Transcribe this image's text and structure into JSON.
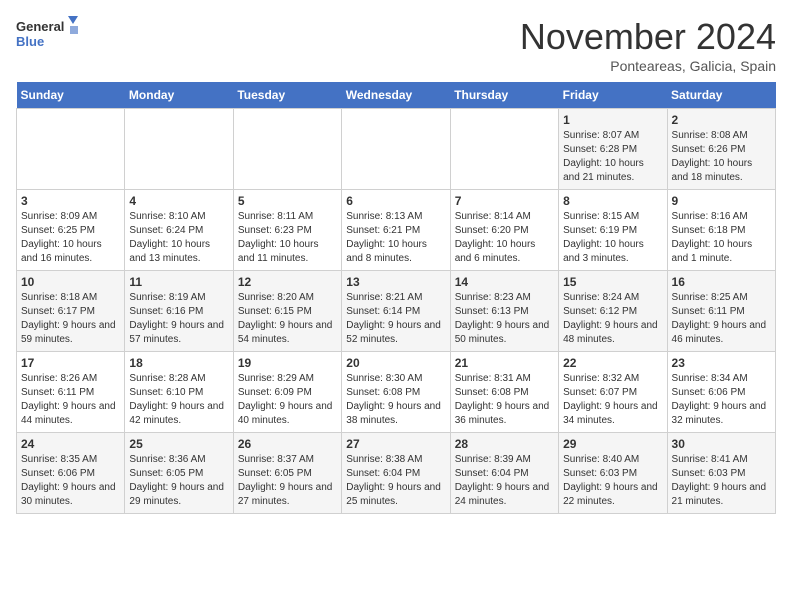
{
  "header": {
    "logo_line1": "General",
    "logo_line2": "Blue",
    "month": "November 2024",
    "location": "Ponteareas, Galicia, Spain"
  },
  "weekdays": [
    "Sunday",
    "Monday",
    "Tuesday",
    "Wednesday",
    "Thursday",
    "Friday",
    "Saturday"
  ],
  "weeks": [
    [
      {
        "day": "",
        "info": ""
      },
      {
        "day": "",
        "info": ""
      },
      {
        "day": "",
        "info": ""
      },
      {
        "day": "",
        "info": ""
      },
      {
        "day": "",
        "info": ""
      },
      {
        "day": "1",
        "info": "Sunrise: 8:07 AM\nSunset: 6:28 PM\nDaylight: 10 hours and 21 minutes."
      },
      {
        "day": "2",
        "info": "Sunrise: 8:08 AM\nSunset: 6:26 PM\nDaylight: 10 hours and 18 minutes."
      }
    ],
    [
      {
        "day": "3",
        "info": "Sunrise: 8:09 AM\nSunset: 6:25 PM\nDaylight: 10 hours and 16 minutes."
      },
      {
        "day": "4",
        "info": "Sunrise: 8:10 AM\nSunset: 6:24 PM\nDaylight: 10 hours and 13 minutes."
      },
      {
        "day": "5",
        "info": "Sunrise: 8:11 AM\nSunset: 6:23 PM\nDaylight: 10 hours and 11 minutes."
      },
      {
        "day": "6",
        "info": "Sunrise: 8:13 AM\nSunset: 6:21 PM\nDaylight: 10 hours and 8 minutes."
      },
      {
        "day": "7",
        "info": "Sunrise: 8:14 AM\nSunset: 6:20 PM\nDaylight: 10 hours and 6 minutes."
      },
      {
        "day": "8",
        "info": "Sunrise: 8:15 AM\nSunset: 6:19 PM\nDaylight: 10 hours and 3 minutes."
      },
      {
        "day": "9",
        "info": "Sunrise: 8:16 AM\nSunset: 6:18 PM\nDaylight: 10 hours and 1 minute."
      }
    ],
    [
      {
        "day": "10",
        "info": "Sunrise: 8:18 AM\nSunset: 6:17 PM\nDaylight: 9 hours and 59 minutes."
      },
      {
        "day": "11",
        "info": "Sunrise: 8:19 AM\nSunset: 6:16 PM\nDaylight: 9 hours and 57 minutes."
      },
      {
        "day": "12",
        "info": "Sunrise: 8:20 AM\nSunset: 6:15 PM\nDaylight: 9 hours and 54 minutes."
      },
      {
        "day": "13",
        "info": "Sunrise: 8:21 AM\nSunset: 6:14 PM\nDaylight: 9 hours and 52 minutes."
      },
      {
        "day": "14",
        "info": "Sunrise: 8:23 AM\nSunset: 6:13 PM\nDaylight: 9 hours and 50 minutes."
      },
      {
        "day": "15",
        "info": "Sunrise: 8:24 AM\nSunset: 6:12 PM\nDaylight: 9 hours and 48 minutes."
      },
      {
        "day": "16",
        "info": "Sunrise: 8:25 AM\nSunset: 6:11 PM\nDaylight: 9 hours and 46 minutes."
      }
    ],
    [
      {
        "day": "17",
        "info": "Sunrise: 8:26 AM\nSunset: 6:11 PM\nDaylight: 9 hours and 44 minutes."
      },
      {
        "day": "18",
        "info": "Sunrise: 8:28 AM\nSunset: 6:10 PM\nDaylight: 9 hours and 42 minutes."
      },
      {
        "day": "19",
        "info": "Sunrise: 8:29 AM\nSunset: 6:09 PM\nDaylight: 9 hours and 40 minutes."
      },
      {
        "day": "20",
        "info": "Sunrise: 8:30 AM\nSunset: 6:08 PM\nDaylight: 9 hours and 38 minutes."
      },
      {
        "day": "21",
        "info": "Sunrise: 8:31 AM\nSunset: 6:08 PM\nDaylight: 9 hours and 36 minutes."
      },
      {
        "day": "22",
        "info": "Sunrise: 8:32 AM\nSunset: 6:07 PM\nDaylight: 9 hours and 34 minutes."
      },
      {
        "day": "23",
        "info": "Sunrise: 8:34 AM\nSunset: 6:06 PM\nDaylight: 9 hours and 32 minutes."
      }
    ],
    [
      {
        "day": "24",
        "info": "Sunrise: 8:35 AM\nSunset: 6:06 PM\nDaylight: 9 hours and 30 minutes."
      },
      {
        "day": "25",
        "info": "Sunrise: 8:36 AM\nSunset: 6:05 PM\nDaylight: 9 hours and 29 minutes."
      },
      {
        "day": "26",
        "info": "Sunrise: 8:37 AM\nSunset: 6:05 PM\nDaylight: 9 hours and 27 minutes."
      },
      {
        "day": "27",
        "info": "Sunrise: 8:38 AM\nSunset: 6:04 PM\nDaylight: 9 hours and 25 minutes."
      },
      {
        "day": "28",
        "info": "Sunrise: 8:39 AM\nSunset: 6:04 PM\nDaylight: 9 hours and 24 minutes."
      },
      {
        "day": "29",
        "info": "Sunrise: 8:40 AM\nSunset: 6:03 PM\nDaylight: 9 hours and 22 minutes."
      },
      {
        "day": "30",
        "info": "Sunrise: 8:41 AM\nSunset: 6:03 PM\nDaylight: 9 hours and 21 minutes."
      }
    ]
  ]
}
